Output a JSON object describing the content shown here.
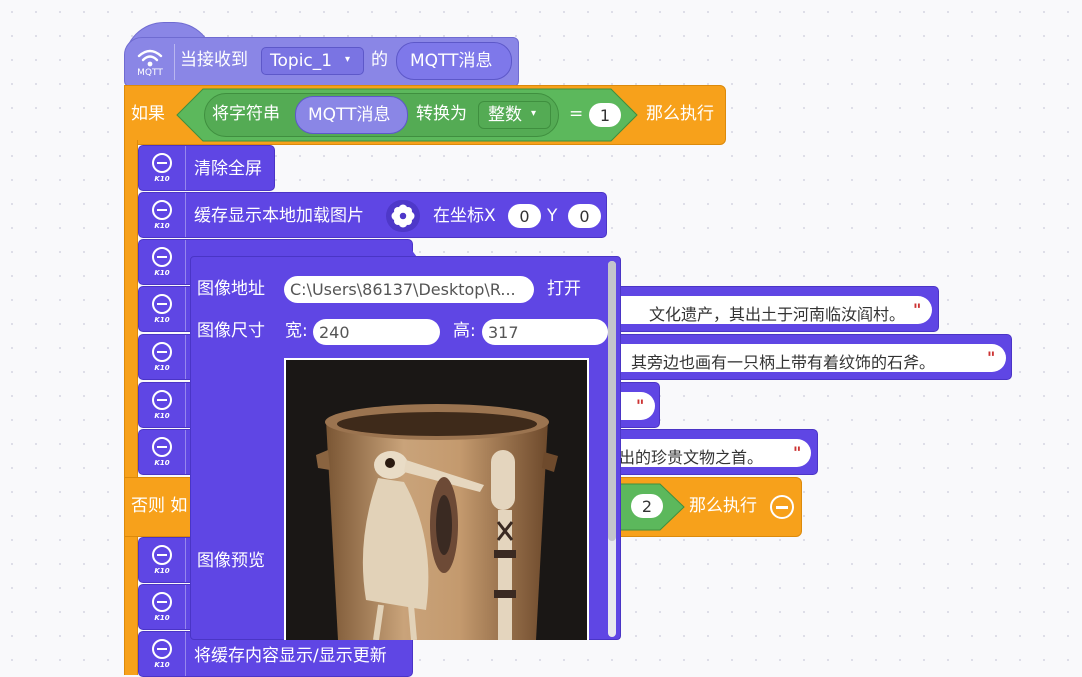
{
  "hat": {
    "icon_label": "MQTT",
    "prefix": "当接收到",
    "topic": "Topic_1",
    "mid": "的",
    "message": "MQTT消息"
  },
  "if_block": {
    "label": "如果",
    "convert_prefix": "将字符串",
    "convert_value": "MQTT消息",
    "convert_mid": "转换为",
    "convert_type": "整数",
    "equals": "=",
    "compare_value": "1",
    "then": "那么执行"
  },
  "blocks": {
    "k10_label": "K10",
    "clear_screen": "清除全屏",
    "cache_image": "缓存显示本地加载图片",
    "at_coord_x": "在坐标X",
    "x_value": "0",
    "y_label": "Y",
    "y_value": "0",
    "line1_text": "文化遗产，其出土于河南临汝阎村。",
    "line2_text": "其旁边也画有一只柄上带有着纹饰的石斧。",
    "line3_text": "",
    "line4_text": "出的珍贵文物之首。",
    "quote": "\"",
    "bottom_block": "将缓存内容显示/显示更新"
  },
  "else_if": {
    "label": "否则 如",
    "compare_value": "2",
    "then": "那么执行"
  },
  "popup": {
    "path_label": "图像地址",
    "path_value": "C:\\Users\\86137\\Desktop\\R...",
    "open_button": "打开",
    "size_label": "图像尺寸",
    "width_label": "宽:",
    "width_value": "240",
    "height_label": "高:",
    "height_value": "317",
    "preview_label": "图像预览"
  }
}
